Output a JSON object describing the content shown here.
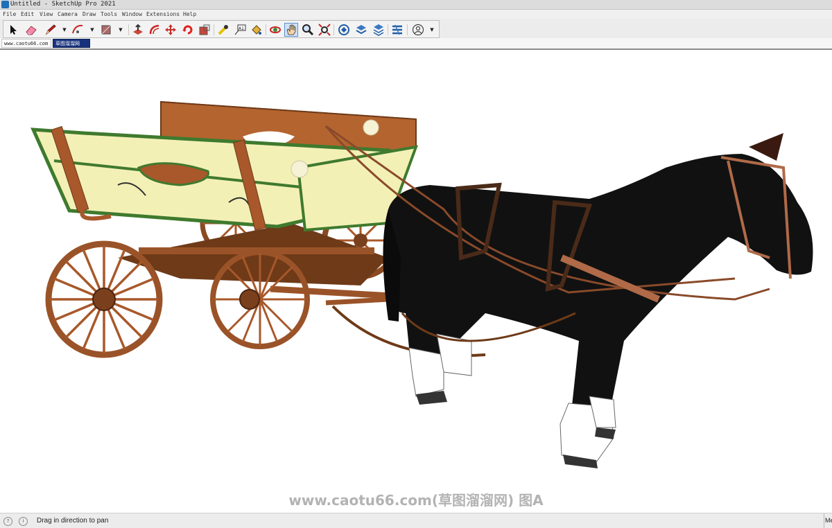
{
  "window": {
    "title": "Untitled - SketchUp Pro 2021"
  },
  "menu": [
    "File",
    "Edit",
    "View",
    "Camera",
    "Draw",
    "Tools",
    "Window",
    "Extensions",
    "Help"
  ],
  "toolbar": {
    "tools": [
      {
        "name": "select-tool",
        "icon": "arrow-pointer-icon"
      },
      {
        "name": "eraser-tool",
        "icon": "eraser-icon"
      },
      {
        "name": "line-tool",
        "icon": "pencil-icon"
      },
      {
        "name": "arc-tool",
        "icon": "arc-icon"
      },
      {
        "name": "shape-tool",
        "icon": "rectangle-icon"
      },
      {
        "name": "push-pull-tool",
        "icon": "push-pull-icon"
      },
      {
        "name": "offset-tool",
        "icon": "offset-icon"
      },
      {
        "name": "move-tool",
        "icon": "move-icon"
      },
      {
        "name": "rotate-tool",
        "icon": "rotate-icon"
      },
      {
        "name": "scale-tool",
        "icon": "scale-icon"
      },
      {
        "name": "tape-measure-tool",
        "icon": "tape-measure-icon"
      },
      {
        "name": "text-tool",
        "icon": "text-label-icon"
      },
      {
        "name": "paint-bucket-tool",
        "icon": "paint-bucket-icon"
      },
      {
        "name": "orbit-tool",
        "icon": "orbit-icon"
      },
      {
        "name": "pan-tool",
        "icon": "hand-icon"
      },
      {
        "name": "zoom-tool",
        "icon": "magnifier-icon"
      },
      {
        "name": "zoom-extents-tool",
        "icon": "zoom-extents-icon"
      },
      {
        "name": "3d-warehouse",
        "icon": "warehouse-icon"
      },
      {
        "name": "extension-warehouse",
        "icon": "extension-icon"
      },
      {
        "name": "layout-send",
        "icon": "layers-icon"
      },
      {
        "name": "extension-manager",
        "icon": "extension-manager-icon"
      },
      {
        "name": "account",
        "icon": "user-account-icon"
      }
    ],
    "active_tool": "pan-tool"
  },
  "scene_tabs": [
    "www.caotu66.com",
    "草图溜溜网"
  ],
  "viewport": {
    "watermark": "www.caotu66.com(草图溜溜网) 图A"
  },
  "status": {
    "message": "Drag in direction to pan",
    "measurements_label": "Measurements"
  },
  "colors": {
    "accent": "#17327d",
    "wood": "#a8582a",
    "panel": "#f3f0b6",
    "trim": "#3f7a2e",
    "horse": "#111111"
  }
}
